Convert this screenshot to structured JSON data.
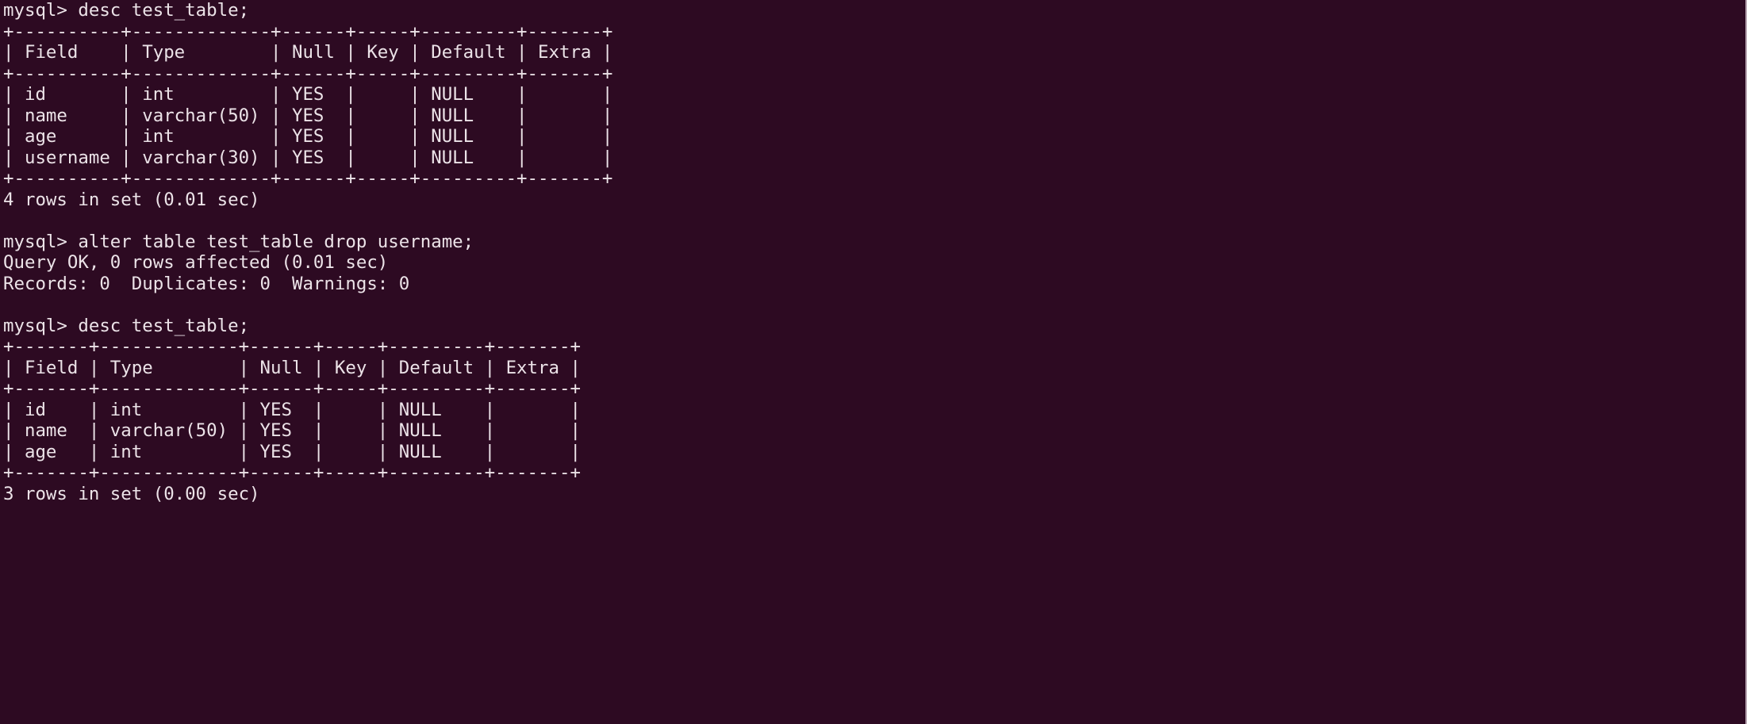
{
  "terminal": {
    "app": "mysql-client-terminal",
    "background_color": "#2d0a22",
    "foreground_color": "#ece3e8",
    "prompt": "mysql> "
  },
  "blocks": [
    {
      "name": "desc-before-drop",
      "command": "mysql> desc test_table;",
      "table": {
        "rule": "+----------+-------------+------+-----+---------+-------+",
        "header": "| Field    | Type        | Null | Key | Default | Extra |",
        "rows": [
          "| id       | int         | YES  |     | NULL    |       |",
          "| name     | varchar(50) | YES  |     | NULL    |       |",
          "| age      | int         | YES  |     | NULL    |       |",
          "| username | varchar(30) | YES  |     | NULL    |       |"
        ]
      },
      "status": "4 rows in set (0.01 sec)"
    },
    {
      "name": "alter-table-drop-username",
      "command": "mysql> alter table test_table drop username;",
      "result_lines": [
        "Query OK, 0 rows affected (0.01 sec)",
        "Records: 0  Duplicates: 0  Warnings: 0"
      ]
    },
    {
      "name": "desc-after-drop",
      "command": "mysql> desc test_table;",
      "table": {
        "rule": "+-------+-------------+------+-----+---------+-------+",
        "header": "| Field | Type        | Null | Key | Default | Extra |",
        "rows": [
          "| id    | int         | YES  |     | NULL    |       |",
          "| name  | varchar(50) | YES  |     | NULL    |       |",
          "| age   | int         | YES  |     | NULL    |       |"
        ]
      },
      "status": "3 rows in set (0.00 sec)"
    }
  ],
  "screen_lines": [
    "mysql> desc test_table;",
    "+----------+-------------+------+-----+---------+-------+",
    "| Field    | Type        | Null | Key | Default | Extra |",
    "+----------+-------------+------+-----+---------+-------+",
    "| id       | int         | YES  |     | NULL    |       |",
    "| name     | varchar(50) | YES  |     | NULL    |       |",
    "| age      | int         | YES  |     | NULL    |       |",
    "| username | varchar(30) | YES  |     | NULL    |       |",
    "+----------+-------------+------+-----+---------+-------+",
    "4 rows in set (0.01 sec)",
    "",
    "mysql> alter table test_table drop username;",
    "Query OK, 0 rows affected (0.01 sec)",
    "Records: 0  Duplicates: 0  Warnings: 0",
    "",
    "mysql> desc test_table;",
    "+-------+-------------+------+-----+---------+-------+",
    "| Field | Type        | Null | Key | Default | Extra |",
    "+-------+-------------+------+-----+---------+-------+",
    "| id    | int         | YES  |     | NULL    |       |",
    "| name  | varchar(50) | YES  |     | NULL    |       |",
    "| age   | int         | YES  |     | NULL    |       |",
    "+-------+-------------+------+-----+---------+-------+",
    "3 rows in set (0.00 sec)"
  ]
}
